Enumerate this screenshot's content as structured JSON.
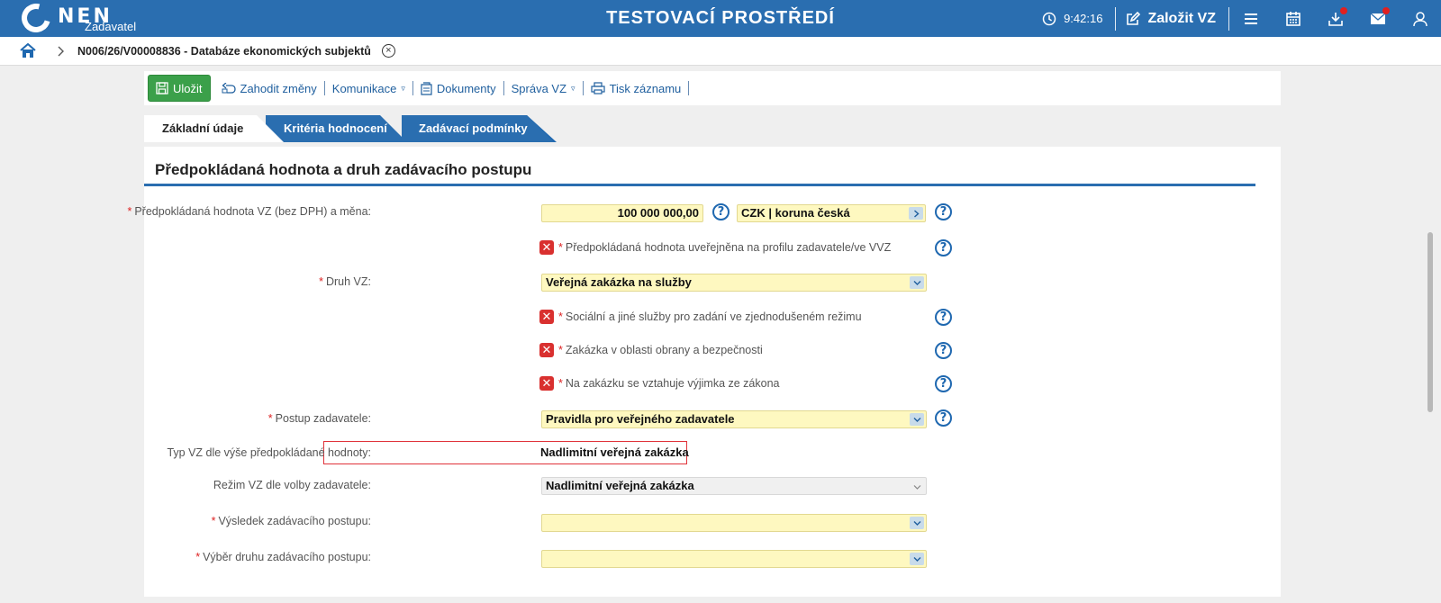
{
  "header": {
    "logo_text": "NEN",
    "logo_sub": "Zadavatel",
    "env_title": "TESTOVACÍ PROSTŘEDÍ",
    "time": "9:42:16",
    "create_label": "Založit VZ"
  },
  "breadcrumb": {
    "title": "N006/26/V00008836 - Databáze ekonomických subjektů",
    "close_glyph": "×"
  },
  "toolbar": {
    "save_label": "Uložit",
    "discard_label": "Zahodit změny",
    "communication_label": "Komunikace",
    "documents_label": "Dokumenty",
    "admin_label": "Správa VZ",
    "print_label": "Tisk záznamu",
    "caret": "▿"
  },
  "tabs": {
    "basic": "Základní údaje",
    "criteria": "Kritéria hodnocení",
    "conditions": "Zadávací podmínky"
  },
  "section": {
    "title": "Předpokládaná hodnota a druh zadávacího postupu"
  },
  "form": {
    "req_mark": "*",
    "help_glyph": "?",
    "x_glyph": "✕",
    "value_label": "Předpokládaná hodnota VZ (bez DPH) a měna:",
    "value_amount": "100 000 000,00",
    "currency": "CZK | koruna česká",
    "published_label": "Předpokládaná hodnota uveřejněna na profilu zadavatele/ve VVZ",
    "type_label": "Druh VZ:",
    "type_value": "Veřejná zakázka na služby",
    "social_label": "Sociální a jiné služby pro zadání ve zjednodušeném režimu",
    "defence_label": "Zakázka v oblasti obrany a bezpečnosti",
    "exemption_label": "Na zakázku se vztahuje výjimka ze zákona",
    "procedure_label": "Postup zadavatele:",
    "procedure_value": "Pravidla pro veřejného zadavatele",
    "vz_type_label": "Typ VZ dle výše předpokládané hodnoty:",
    "vz_type_value": "Nadlimitní veřejná zakázka",
    "regime_label": "Režim VZ dle volby zadavatele:",
    "regime_value": "Nadlimitní veřejná zakázka",
    "result_label": "Výsledek zadávacího postupu:",
    "result_value": "",
    "choice_label": "Výběr druhu zadávacího postupu:",
    "choice_value": ""
  },
  "colors": {
    "brand_blue": "#2a6eb0",
    "save_green": "#3ba04a",
    "required_red": "#d22222",
    "field_yellow": "#fef8c0"
  },
  "icons": [
    "clock-icon",
    "edit-icon",
    "menu-icon",
    "calendar-icon",
    "download-icon",
    "mail-icon",
    "user-icon",
    "home-icon",
    "chevron-right-icon",
    "close-icon",
    "save-icon",
    "undo-icon",
    "document-icon",
    "print-icon",
    "help-icon",
    "checkbox-x-icon",
    "chevron-down-icon"
  ]
}
